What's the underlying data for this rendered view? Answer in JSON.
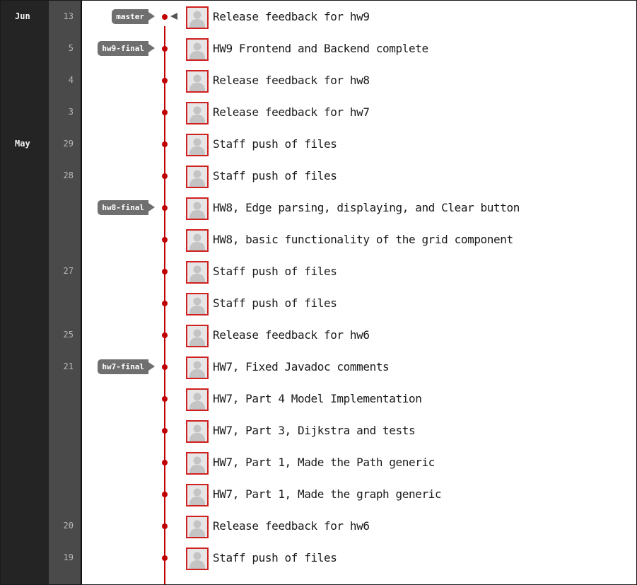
{
  "commits": [
    {
      "month": "Jun",
      "day": "13",
      "tag": "master",
      "head": true,
      "message": "Release feedback for hw9"
    },
    {
      "month": "",
      "day": "5",
      "tag": "hw9-final",
      "head": false,
      "message": "HW9 Frontend and Backend complete"
    },
    {
      "month": "",
      "day": "4",
      "tag": "",
      "head": false,
      "message": "Release feedback for hw8"
    },
    {
      "month": "",
      "day": "3",
      "tag": "",
      "head": false,
      "message": "Release feedback for hw7"
    },
    {
      "month": "May",
      "day": "29",
      "tag": "",
      "head": false,
      "message": "Staff push of files"
    },
    {
      "month": "",
      "day": "28",
      "tag": "",
      "head": false,
      "message": "Staff push of files"
    },
    {
      "month": "",
      "day": "",
      "tag": "hw8-final",
      "head": false,
      "message": "HW8, Edge parsing, displaying, and Clear button"
    },
    {
      "month": "",
      "day": "",
      "tag": "",
      "head": false,
      "message": "HW8, basic functionality of the grid component"
    },
    {
      "month": "",
      "day": "27",
      "tag": "",
      "head": false,
      "message": "Staff push of files"
    },
    {
      "month": "",
      "day": "",
      "tag": "",
      "head": false,
      "message": "Staff push of files"
    },
    {
      "month": "",
      "day": "25",
      "tag": "",
      "head": false,
      "message": "Release feedback for hw6"
    },
    {
      "month": "",
      "day": "21",
      "tag": "hw7-final",
      "head": false,
      "message": "HW7, Fixed Javadoc comments"
    },
    {
      "month": "",
      "day": "",
      "tag": "",
      "head": false,
      "message": "HW7, Part 4 Model Implementation"
    },
    {
      "month": "",
      "day": "",
      "tag": "",
      "head": false,
      "message": "HW7, Part 3, Dijkstra and tests"
    },
    {
      "month": "",
      "day": "",
      "tag": "",
      "head": false,
      "message": "HW7, Part 1, Made the Path generic"
    },
    {
      "month": "",
      "day": "",
      "tag": "",
      "head": false,
      "message": "HW7, Part 1, Made the graph generic"
    },
    {
      "month": "",
      "day": "20",
      "tag": "",
      "head": false,
      "message": "Release feedback for hw6"
    },
    {
      "month": "",
      "day": "19",
      "tag": "",
      "head": false,
      "message": "Staff push of files"
    }
  ],
  "icons": {
    "avatar": "default-user-avatar-icon",
    "head": "head-pointer-icon"
  },
  "colors": {
    "graph": "#c00000",
    "tag": "#6f6f6f",
    "avatar_border": "#d02020"
  }
}
